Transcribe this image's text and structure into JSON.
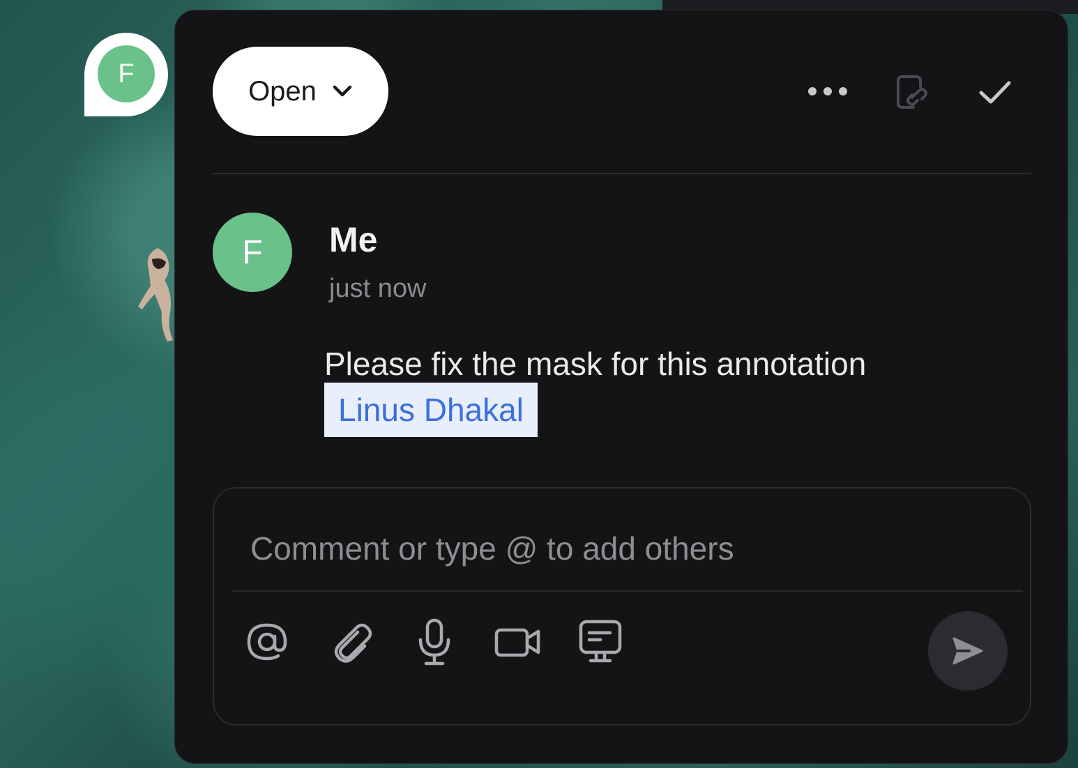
{
  "pin": {
    "avatar_initial": "F"
  },
  "header": {
    "status_label": "Open",
    "more_icon": "more-horizontal-icon",
    "link_icon": "copy-link-icon",
    "resolve_icon": "check-icon"
  },
  "comment": {
    "author_initial": "F",
    "author_name": "Me",
    "timestamp": "just now",
    "text": "Please fix the mask for this annotation",
    "mention": "Linus Dhakal"
  },
  "composer": {
    "placeholder": "Comment or type @ to add others",
    "tools": [
      "mention-icon",
      "attachment-icon",
      "microphone-icon",
      "video-camera-icon",
      "screen-share-icon"
    ],
    "send_icon": "send-icon"
  },
  "colors": {
    "avatar": "#6bc18a",
    "panel_bg": "#141416",
    "mention_bg": "#e8eefc",
    "mention_text": "#3a6fdc"
  }
}
